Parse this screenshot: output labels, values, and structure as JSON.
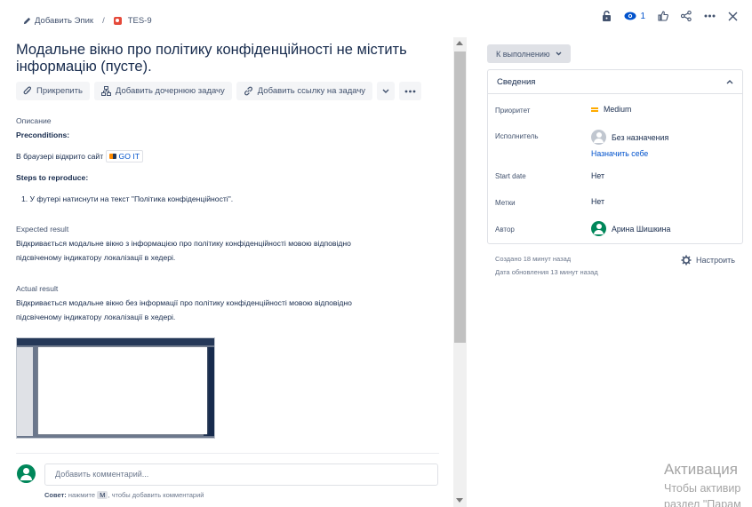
{
  "breadcrumb": {
    "add_epic": "Добавить Эпик",
    "issue_key": "TES-9"
  },
  "top_actions": {
    "watch_count": "1"
  },
  "issue": {
    "title": "Модальне вікно про політику конфіденційності не містить інформацію (пусте)."
  },
  "buttons": {
    "attach": "Прикрепить",
    "add_child": "Добавить дочернюю задачу",
    "add_link": "Добавить ссылку на задачу"
  },
  "description": {
    "label": "Описание",
    "preconditions_title": "Preconditions:",
    "preconditions_text": "В браузері відкрито сайт",
    "site_tag": "GO IT",
    "steps_title": "Steps to reproduce:",
    "step_1": "1. У футері натиснути на текст \"Політика конфіденційності\".",
    "expected_title": "Expected result",
    "expected_line1": "Відкривається модальне вікно з інформацією про політику конфіденційності мовою відповідно",
    "expected_line2": "підсвіченому індикатору локалізації в хедері.",
    "actual_title": "Actual result",
    "actual_line1": "Відкривається модальне вікно без інформації про політику конфіденційності мовою відповідно",
    "actual_line2": "підсвіченому індикатору локалізації в хедері."
  },
  "comment": {
    "placeholder": "Добавить комментарий...",
    "tip_label": "Совет:",
    "tip_before": "нажмите",
    "tip_key": "M",
    "tip_after": ", чтобы добавить комментарий"
  },
  "status": {
    "label": "К выполнению"
  },
  "details": {
    "heading": "Сведения",
    "priority_label": "Приоритет",
    "priority_value": "Medium",
    "assignee_label": "Исполнитель",
    "assignee_value": "Без назначения",
    "assign_to_me": "Назначить себе",
    "start_date_label": "Start date",
    "start_date_value": "Нет",
    "labels_label": "Метки",
    "labels_value": "Нет",
    "author_label": "Автор",
    "author_value": "Арина Шишкина"
  },
  "meta": {
    "created": "Создано 18 минут назад",
    "updated": "Дата обновления 13 минут назад",
    "configure": "Настроить"
  },
  "watermark": {
    "line1": "Активация",
    "line2": "Чтобы активир",
    "line3": "раздел \"Парам"
  },
  "colors": {
    "link": "#0052cc",
    "text": "#172b4d",
    "bug": "#e5493a",
    "priority_medium": "#ffab00",
    "avatar_green": "#00875a"
  }
}
